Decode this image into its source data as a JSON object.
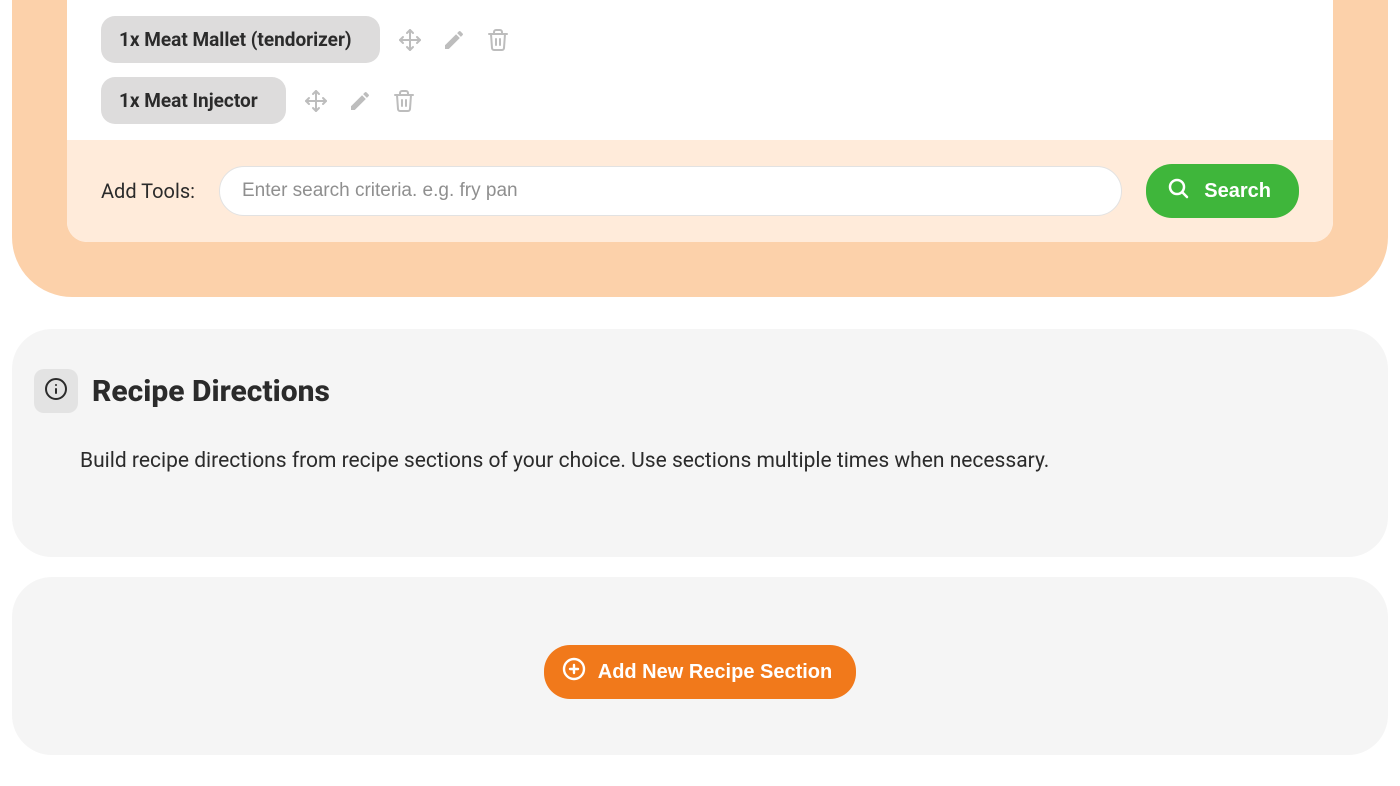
{
  "tools": {
    "items": [
      {
        "label": "1x Meat Mallet (tendorizer)"
      },
      {
        "label": "1x Meat Injector"
      }
    ],
    "add_label": "Add Tools:",
    "search_placeholder": "Enter search criteria. e.g. fry pan",
    "search_button": "Search"
  },
  "directions": {
    "title": "Recipe Directions",
    "description": "Build recipe directions from recipe sections of your choice. Use sections multiple times when necessary."
  },
  "add_section": {
    "label": "Add New Recipe Section"
  }
}
